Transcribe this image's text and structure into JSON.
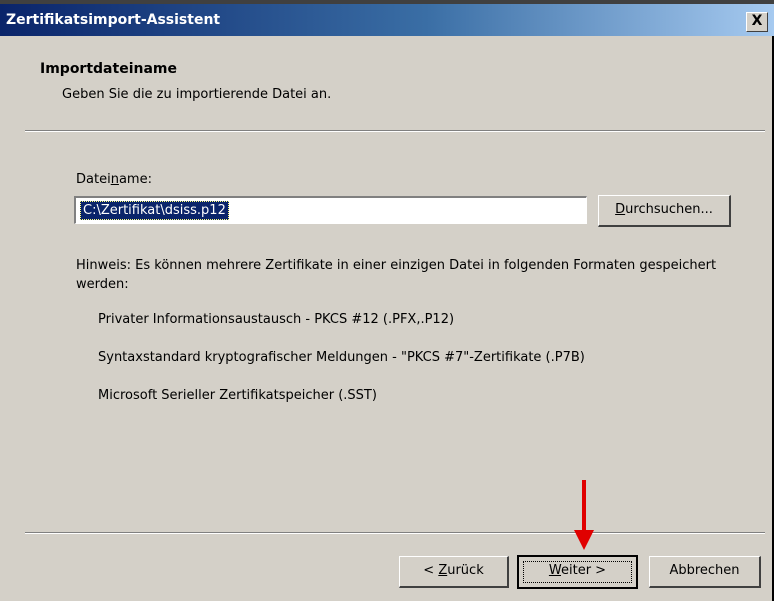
{
  "window": {
    "title": "Zertifikatsimport-Assistent",
    "close_glyph": "X"
  },
  "header": {
    "title": "Importdateiname",
    "subtitle": "Geben Sie die zu importierende Datei an."
  },
  "file": {
    "label_pre": "Datei",
    "label_accel": "n",
    "label_post": "ame:",
    "value": "C:\\Zertifikat\\dsiss.p12",
    "browse_accel": "D",
    "browse_rest": "urchsuchen..."
  },
  "hint": "Hinweis: Es können mehrere Zertifikate in einer einzigen Datei in folgenden Formaten gespeichert werden:",
  "formats": [
    "Privater Informationsaustausch - PKCS #12 (.PFX,.P12)",
    "Syntaxstandard kryptografischer Meldungen - \"PKCS #7\"-Zertifikate (.P7B)",
    "Microsoft Serieller Zertifikatspeicher (.SST)"
  ],
  "buttons": {
    "back_pre": "< ",
    "back_accel": "Z",
    "back_rest": "urück",
    "next_accel": "W",
    "next_rest": "eiter >",
    "cancel": "Abbrechen"
  },
  "colors": {
    "titlebar_start": "#0a246a",
    "arrow": "#e00000"
  },
  "annotation": {
    "icon": "red-arrow-down-icon"
  }
}
